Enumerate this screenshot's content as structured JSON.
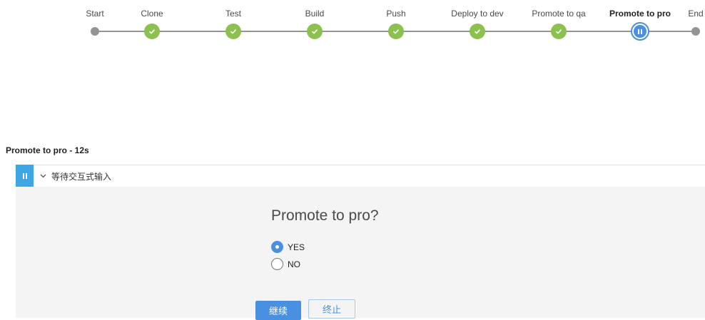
{
  "pipeline": {
    "stages": [
      {
        "label": "Start",
        "status": "start"
      },
      {
        "label": "Clone",
        "status": "success"
      },
      {
        "label": "Test",
        "status": "success"
      },
      {
        "label": "Build",
        "status": "success"
      },
      {
        "label": "Push",
        "status": "success"
      },
      {
        "label": "Deploy to dev",
        "status": "success"
      },
      {
        "label": "Promote to qa",
        "status": "success"
      },
      {
        "label": "Promote to pro",
        "status": "paused"
      },
      {
        "label": "End",
        "status": "end"
      }
    ]
  },
  "step": {
    "title": "Promote to pro - 12s",
    "description": "等待交互式输入"
  },
  "input": {
    "prompt": "Promote to pro?",
    "options": [
      {
        "label": "YES",
        "checked": true
      },
      {
        "label": "NO",
        "checked": false
      }
    ],
    "continue_label": "继续",
    "abort_label": "终止"
  },
  "colors": {
    "success": "#8cc04f",
    "paused": "#4a90e2",
    "track": "#949494",
    "status_bar": "#3ea6e2"
  }
}
